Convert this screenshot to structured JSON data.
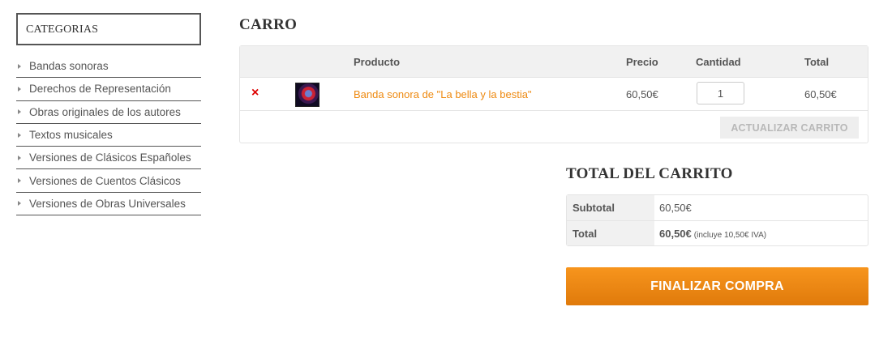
{
  "sidebar": {
    "title": "CATEGORIAS",
    "items": [
      {
        "label": "Bandas sonoras"
      },
      {
        "label": "Derechos de Representación"
      },
      {
        "label": "Obras originales de los autores"
      },
      {
        "label": "Textos musicales"
      },
      {
        "label": "Versiones de Clásicos Españoles"
      },
      {
        "label": "Versiones de Cuentos Clásicos"
      },
      {
        "label": "Versiones de Obras Universales"
      }
    ]
  },
  "cart": {
    "title": "CARRO",
    "headers": {
      "product": "Producto",
      "price": "Precio",
      "quantity": "Cantidad",
      "total": "Total"
    },
    "items": [
      {
        "remove": "×",
        "name": "Banda sonora de \"La bella y la bestia\"",
        "price": "60,50€",
        "quantity": "1",
        "total": "60,50€"
      }
    ],
    "update_label": "ACTUALIZAR CARRITO"
  },
  "totals": {
    "title": "TOTAL DEL CARRITO",
    "subtotal_label": "Subtotal",
    "subtotal_value": "60,50€",
    "total_label": "Total",
    "total_value": "60,50€",
    "total_note": "(incluye 10,50€ IVA)"
  },
  "checkout_label": "FINALIZAR COMPRA",
  "colors": {
    "accent": "#f08a12",
    "remove": "#dd0000"
  }
}
